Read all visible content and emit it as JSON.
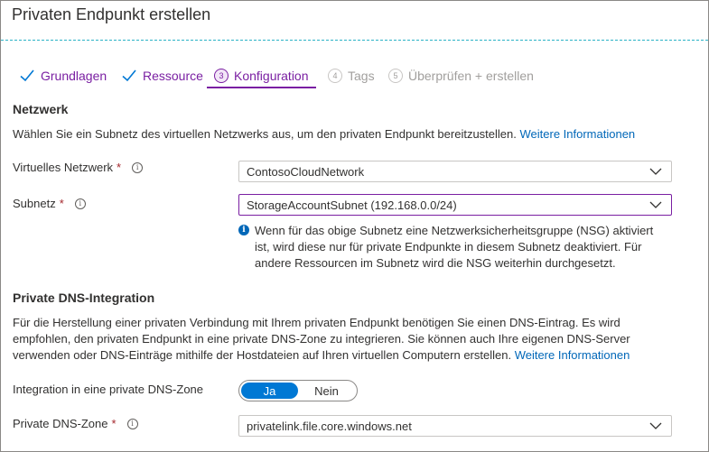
{
  "page": {
    "title": "Privaten Endpunkt erstellen"
  },
  "tabs": [
    {
      "label": "Grundlagen",
      "state": "done"
    },
    {
      "label": "Ressource",
      "state": "done"
    },
    {
      "label": "Konfiguration",
      "state": "current",
      "number": "3"
    },
    {
      "label": "Tags",
      "state": "disabled",
      "number": "4"
    },
    {
      "label": "Überprüfen + erstellen",
      "state": "disabled",
      "number": "5"
    }
  ],
  "network": {
    "heading": "Netzwerk",
    "description": "Wählen Sie ein Subnetz des virtuellen Netzwerks aus, um den privaten Endpunkt bereitzustellen.",
    "link": "Weitere Informationen",
    "vnet_label": "Virtuelles Netzwerk",
    "vnet_value": "ContosoCloudNetwork",
    "subnet_label": "Subnetz",
    "subnet_value": "StorageAccountSubnet (192.168.0.0/24)",
    "required_mark": "*",
    "info_glyph": "i",
    "nsg_info_lines": [
      "Wenn für das obige Subnetz eine Netzwerksicherheitsgruppe (NSG) aktiviert",
      "ist, wird diese nur für private Endpunkte in diesem Subnetz deaktiviert. Für",
      "andere Ressourcen im Subnetz wird die NSG weiterhin durchgesetzt."
    ]
  },
  "dns": {
    "heading": "Private DNS-Integration",
    "description_lines": [
      "Für die Herstellung einer privaten Verbindung mit Ihrem privaten Endpunkt benötigen Sie einen DNS-Eintrag. Es wird",
      "empfohlen, den privaten Endpunkt in eine private DNS-Zone zu integrieren. Sie können auch Ihre eigenen DNS-Server",
      "verwenden oder DNS-Einträge mithilfe der Hostdateien auf Ihren virtuellen Computern erstellen."
    ],
    "link": "Weitere Informationen",
    "integration_label": "Integration in eine private DNS-Zone",
    "toggle_yes": "Ja",
    "toggle_no": "Nein",
    "zone_label": "Private DNS-Zone",
    "zone_value": "privatelink.file.core.windows.net"
  },
  "colors": {
    "accent": "#7a1fa2",
    "primary": "#0078d4",
    "link": "#0067b8",
    "required": "#a4262c",
    "dash": "#2bb3c6"
  }
}
